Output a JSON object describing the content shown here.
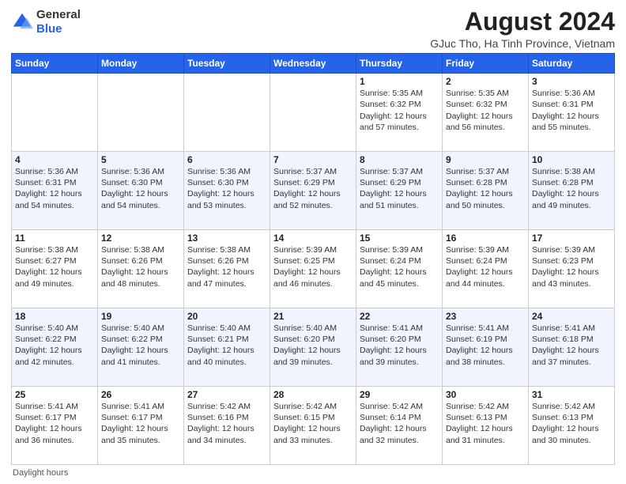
{
  "header": {
    "logo_general": "General",
    "logo_blue": "Blue",
    "month_year": "August 2024",
    "location": "GJuc Tho, Ha Tinh Province, Vietnam"
  },
  "days_of_week": [
    "Sunday",
    "Monday",
    "Tuesday",
    "Wednesday",
    "Thursday",
    "Friday",
    "Saturday"
  ],
  "weeks": [
    [
      {
        "day": "",
        "info": ""
      },
      {
        "day": "",
        "info": ""
      },
      {
        "day": "",
        "info": ""
      },
      {
        "day": "",
        "info": ""
      },
      {
        "day": "1",
        "info": "Sunrise: 5:35 AM\nSunset: 6:32 PM\nDaylight: 12 hours and 57 minutes."
      },
      {
        "day": "2",
        "info": "Sunrise: 5:35 AM\nSunset: 6:32 PM\nDaylight: 12 hours and 56 minutes."
      },
      {
        "day": "3",
        "info": "Sunrise: 5:36 AM\nSunset: 6:31 PM\nDaylight: 12 hours and 55 minutes."
      }
    ],
    [
      {
        "day": "4",
        "info": "Sunrise: 5:36 AM\nSunset: 6:31 PM\nDaylight: 12 hours and 54 minutes."
      },
      {
        "day": "5",
        "info": "Sunrise: 5:36 AM\nSunset: 6:30 PM\nDaylight: 12 hours and 54 minutes."
      },
      {
        "day": "6",
        "info": "Sunrise: 5:36 AM\nSunset: 6:30 PM\nDaylight: 12 hours and 53 minutes."
      },
      {
        "day": "7",
        "info": "Sunrise: 5:37 AM\nSunset: 6:29 PM\nDaylight: 12 hours and 52 minutes."
      },
      {
        "day": "8",
        "info": "Sunrise: 5:37 AM\nSunset: 6:29 PM\nDaylight: 12 hours and 51 minutes."
      },
      {
        "day": "9",
        "info": "Sunrise: 5:37 AM\nSunset: 6:28 PM\nDaylight: 12 hours and 50 minutes."
      },
      {
        "day": "10",
        "info": "Sunrise: 5:38 AM\nSunset: 6:28 PM\nDaylight: 12 hours and 49 minutes."
      }
    ],
    [
      {
        "day": "11",
        "info": "Sunrise: 5:38 AM\nSunset: 6:27 PM\nDaylight: 12 hours and 49 minutes."
      },
      {
        "day": "12",
        "info": "Sunrise: 5:38 AM\nSunset: 6:26 PM\nDaylight: 12 hours and 48 minutes."
      },
      {
        "day": "13",
        "info": "Sunrise: 5:38 AM\nSunset: 6:26 PM\nDaylight: 12 hours and 47 minutes."
      },
      {
        "day": "14",
        "info": "Sunrise: 5:39 AM\nSunset: 6:25 PM\nDaylight: 12 hours and 46 minutes."
      },
      {
        "day": "15",
        "info": "Sunrise: 5:39 AM\nSunset: 6:24 PM\nDaylight: 12 hours and 45 minutes."
      },
      {
        "day": "16",
        "info": "Sunrise: 5:39 AM\nSunset: 6:24 PM\nDaylight: 12 hours and 44 minutes."
      },
      {
        "day": "17",
        "info": "Sunrise: 5:39 AM\nSunset: 6:23 PM\nDaylight: 12 hours and 43 minutes."
      }
    ],
    [
      {
        "day": "18",
        "info": "Sunrise: 5:40 AM\nSunset: 6:22 PM\nDaylight: 12 hours and 42 minutes."
      },
      {
        "day": "19",
        "info": "Sunrise: 5:40 AM\nSunset: 6:22 PM\nDaylight: 12 hours and 41 minutes."
      },
      {
        "day": "20",
        "info": "Sunrise: 5:40 AM\nSunset: 6:21 PM\nDaylight: 12 hours and 40 minutes."
      },
      {
        "day": "21",
        "info": "Sunrise: 5:40 AM\nSunset: 6:20 PM\nDaylight: 12 hours and 39 minutes."
      },
      {
        "day": "22",
        "info": "Sunrise: 5:41 AM\nSunset: 6:20 PM\nDaylight: 12 hours and 39 minutes."
      },
      {
        "day": "23",
        "info": "Sunrise: 5:41 AM\nSunset: 6:19 PM\nDaylight: 12 hours and 38 minutes."
      },
      {
        "day": "24",
        "info": "Sunrise: 5:41 AM\nSunset: 6:18 PM\nDaylight: 12 hours and 37 minutes."
      }
    ],
    [
      {
        "day": "25",
        "info": "Sunrise: 5:41 AM\nSunset: 6:17 PM\nDaylight: 12 hours and 36 minutes."
      },
      {
        "day": "26",
        "info": "Sunrise: 5:41 AM\nSunset: 6:17 PM\nDaylight: 12 hours and 35 minutes."
      },
      {
        "day": "27",
        "info": "Sunrise: 5:42 AM\nSunset: 6:16 PM\nDaylight: 12 hours and 34 minutes."
      },
      {
        "day": "28",
        "info": "Sunrise: 5:42 AM\nSunset: 6:15 PM\nDaylight: 12 hours and 33 minutes."
      },
      {
        "day": "29",
        "info": "Sunrise: 5:42 AM\nSunset: 6:14 PM\nDaylight: 12 hours and 32 minutes."
      },
      {
        "day": "30",
        "info": "Sunrise: 5:42 AM\nSunset: 6:13 PM\nDaylight: 12 hours and 31 minutes."
      },
      {
        "day": "31",
        "info": "Sunrise: 5:42 AM\nSunset: 6:13 PM\nDaylight: 12 hours and 30 minutes."
      }
    ]
  ],
  "footer": {
    "note": "Daylight hours"
  }
}
